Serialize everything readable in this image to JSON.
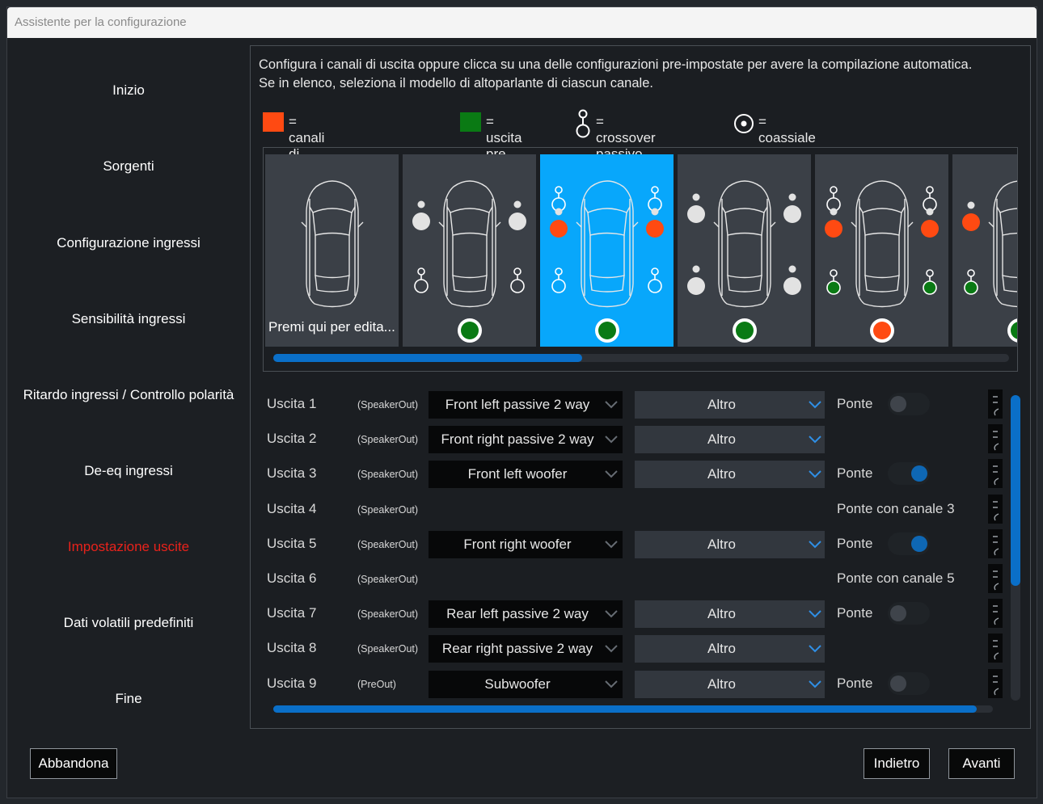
{
  "window": {
    "title": "Assistente per la configurazione"
  },
  "nav": {
    "items": [
      "Inizio",
      "Sorgenti",
      "Configurazione ingressi",
      "Sensibilità ingressi",
      "Ritardo ingressi / Controllo polarità",
      "De-eq ingressi",
      "Impostazione uscite",
      "Dati volatili predefiniti",
      "Fine"
    ],
    "active_index": 6,
    "active_color": "#e8221b"
  },
  "intro": {
    "line1": "Configura i canali di uscita oppure clicca su una delle configurazioni pre-impostate per avere la compilazione automatica.",
    "line2": "Se in elenco, seleziona il modello di altoparlante di ciascun canale."
  },
  "legend": {
    "bridge": {
      "label": "= canali di uscita a ponte",
      "color": "#ff4a12"
    },
    "pre": {
      "label": "= uscita pre",
      "color": "#0a7a14"
    },
    "crossover": {
      "label": "= crossover passivo",
      "icon": "passive-crossover-icon"
    },
    "coax": {
      "label": "= coassiale",
      "icon": "coaxial-icon"
    }
  },
  "presets": {
    "selected_index": 2,
    "selected_color": "#08a7fb",
    "tiles": [
      {
        "caption": "Premi qui per edita..."
      },
      {
        "caption": ""
      },
      {
        "caption": ""
      },
      {
        "caption": ""
      },
      {
        "caption": ""
      },
      {
        "caption": ""
      }
    ]
  },
  "outputs": {
    "rows": [
      {
        "label": "Uscita 1",
        "type": "(SpeakerOut)",
        "speaker": "Front left passive 2 way",
        "model": "Altro",
        "bridge": "Ponte",
        "toggle": "off"
      },
      {
        "label": "Uscita 2",
        "type": "(SpeakerOut)",
        "speaker": "Front right passive 2 way",
        "model": "Altro",
        "bridge": "",
        "toggle": "none"
      },
      {
        "label": "Uscita 3",
        "type": "(SpeakerOut)",
        "speaker": "Front left woofer",
        "model": "Altro",
        "bridge": "Ponte",
        "toggle": "on"
      },
      {
        "label": "Uscita 4",
        "type": "(SpeakerOut)",
        "speaker": "",
        "model": "",
        "bridge": "Ponte con canale 3",
        "toggle": "none"
      },
      {
        "label": "Uscita 5",
        "type": "(SpeakerOut)",
        "speaker": "Front right woofer",
        "model": "Altro",
        "bridge": "Ponte",
        "toggle": "on"
      },
      {
        "label": "Uscita 6",
        "type": "(SpeakerOut)",
        "speaker": "",
        "model": "",
        "bridge": "Ponte con canale 5",
        "toggle": "none"
      },
      {
        "label": "Uscita 7",
        "type": "(SpeakerOut)",
        "speaker": "Rear left passive 2 way",
        "model": "Altro",
        "bridge": "Ponte",
        "toggle": "off"
      },
      {
        "label": "Uscita 8",
        "type": "(SpeakerOut)",
        "speaker": "Rear right passive 2 way",
        "model": "Altro",
        "bridge": "",
        "toggle": "none"
      },
      {
        "label": "Uscita 9",
        "type": "(PreOut)",
        "speaker": "Subwoofer",
        "model": "Altro",
        "bridge": "Ponte",
        "toggle": "off"
      }
    ]
  },
  "buttons": {
    "abort": "Abbandona",
    "back": "Indietro",
    "next": "Avanti"
  }
}
